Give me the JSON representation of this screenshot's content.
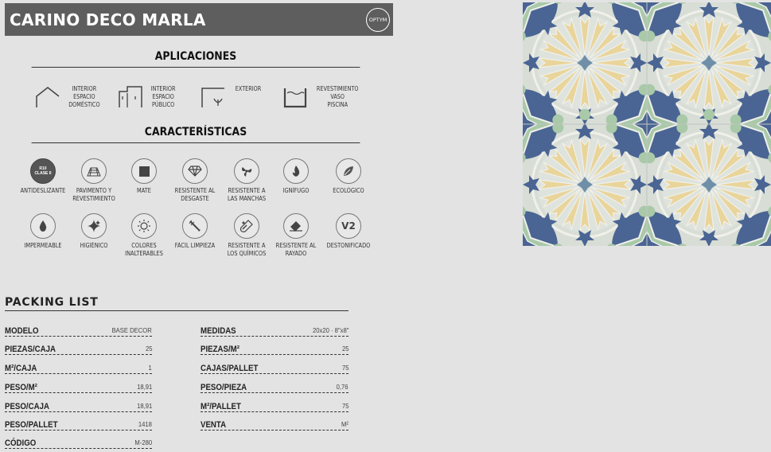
{
  "header": {
    "title": "CARINO DECO MARLA",
    "badge": "OPTYM"
  },
  "aplicaciones": {
    "heading": "APLICACIONES",
    "items": [
      {
        "icon": "house-icon",
        "label": "INTERIOR\nESPACIO\nDOMÉSTICO"
      },
      {
        "icon": "building-icon",
        "label": "INTERIOR\nESPACIO\nPÚBLICO"
      },
      {
        "icon": "exterior-plant-icon",
        "label": "EXTERIOR"
      },
      {
        "icon": "pool-icon",
        "label": "REVESTIMIENTO\nVASO\nPISCINA"
      }
    ]
  },
  "caracteristicas": {
    "heading": "CARACTERÍSTICAS",
    "badge_text": "R10\nCLASE II",
    "items": [
      {
        "icon": "anti-slip-icon",
        "label": "ANTIDESLIZANTE"
      },
      {
        "icon": "floor-wall-icon",
        "label": "PAVIMENTO Y\nREVESTIMIENTO"
      },
      {
        "icon": "matte-square-icon",
        "label": "MATE"
      },
      {
        "icon": "diamond-icon",
        "label": "RESISTENTE AL\nDESGASTE"
      },
      {
        "icon": "stain-icon",
        "label": "RESISTENTE A\nLAS MANCHAS"
      },
      {
        "icon": "flame-icon",
        "label": "IGNÍFUGO"
      },
      {
        "icon": "leaf-icon",
        "label": "ECOLÓGICO"
      },
      {
        "icon": "water-drop-icon",
        "label": "IMPERMEABLE"
      },
      {
        "icon": "sparkle-icon",
        "label": "HIGIÉNICO"
      },
      {
        "icon": "sun-icon",
        "label": "COLORES\nINALTERABLES"
      },
      {
        "icon": "cleaning-icon",
        "label": "FÁCIL LIMPIEZA"
      },
      {
        "icon": "chemical-icon",
        "label": "RESISTENTE A\nLOS QUÍMICOS"
      },
      {
        "icon": "scratch-icon",
        "label": "RESISTENTE AL\nRAYADO"
      },
      {
        "icon": "v2-icon",
        "label": "DESTONIFICADO",
        "glyph": "V2"
      }
    ]
  },
  "packing": {
    "title": "PACKING LIST",
    "left": [
      {
        "key": "MODELO",
        "value": "BASE DECOR"
      },
      {
        "key": "PIEZAS/CAJA",
        "value": "25"
      },
      {
        "key": "M²/CAJA",
        "value": "1"
      },
      {
        "key": "PESO/M²",
        "value": "18,91"
      },
      {
        "key": "PESO/CAJA",
        "value": "18,91"
      },
      {
        "key": "PESO/PALLET",
        "value": "1418"
      },
      {
        "key": "CÓDIGO",
        "value": "M-280"
      }
    ],
    "right": [
      {
        "key": "MEDIDAS",
        "value": "20x20 · 8\"x8\""
      },
      {
        "key": "PIEZAS/M²",
        "value": "25"
      },
      {
        "key": "CAJAS/PALLET",
        "value": "75"
      },
      {
        "key": "PESO/PIEZA",
        "value": "0,76"
      },
      {
        "key": "M²/PALLET",
        "value": "75"
      },
      {
        "key": "VENTA",
        "value": "M²"
      }
    ]
  },
  "colors": {
    "header_bg": "#5e5e5e",
    "tile_blue": "#4a6593",
    "tile_yellow": "#e9d49a",
    "tile_green": "#a9c9a9"
  }
}
